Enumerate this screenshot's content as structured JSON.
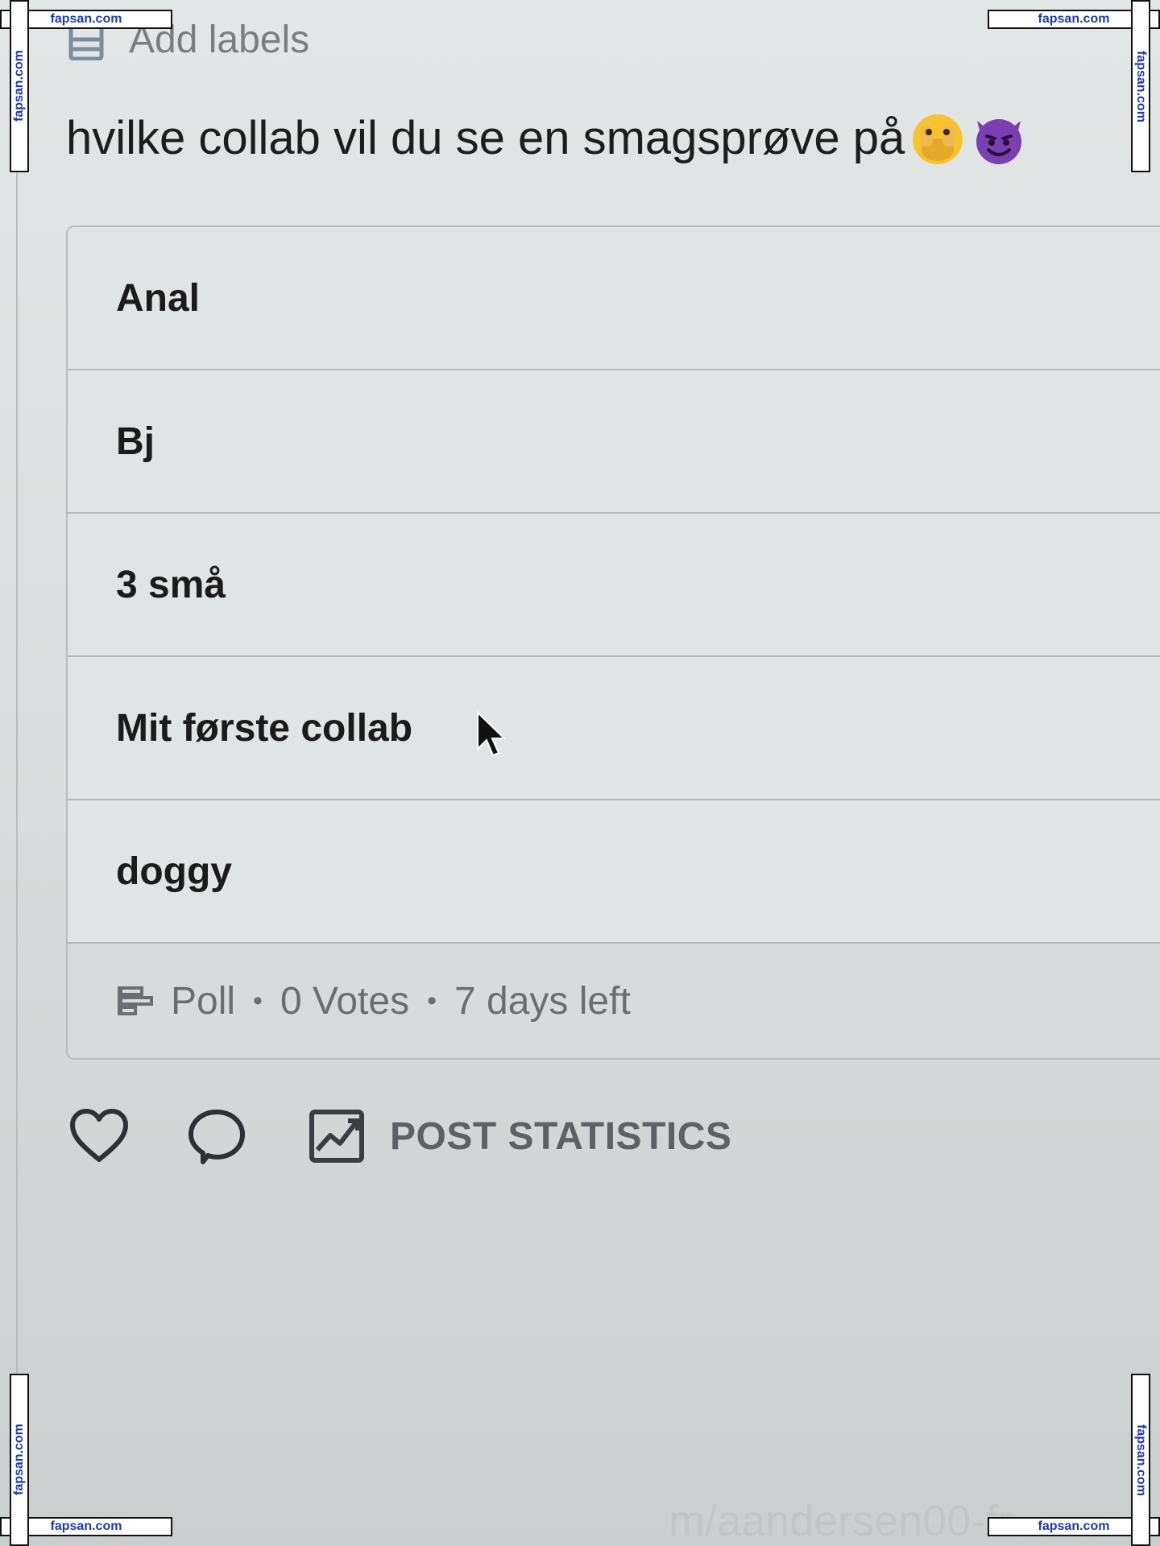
{
  "header": {
    "add_labels": "Add labels"
  },
  "post": {
    "text": "hvilke collab vil du se en smagsprøve på"
  },
  "poll": {
    "options": [
      {
        "label": "Anal"
      },
      {
        "label": "Bj"
      },
      {
        "label": "3 små"
      },
      {
        "label": "Mit første collab"
      },
      {
        "label": "doggy"
      }
    ],
    "footer": {
      "type_label": "Poll",
      "separator": "•",
      "votes": "0 Votes",
      "time_left": "7 days left"
    }
  },
  "actions": {
    "stats_label": "POST STATISTICS"
  },
  "watermark": {
    "text": "fapsan.com",
    "faint_url": "m/aandersen00-fr"
  },
  "icons": {
    "labels": "labels-icon",
    "poll": "poll-icon",
    "like": "heart-icon",
    "comment": "comment-icon",
    "stats": "chart-icon",
    "cursor": "mouse-cursor-icon",
    "emoji_1": "face-with-hand-over-mouth-emoji",
    "emoji_2": "smiling-devil-emoji"
  },
  "colors": {
    "background": "#e0e3e3",
    "text_primary": "#1a1a1a",
    "text_muted": "#6a6e72",
    "emoji_yellow": "#f5c331",
    "emoji_purple": "#7a3fb0",
    "watermark_blue": "#1e3aa8"
  }
}
